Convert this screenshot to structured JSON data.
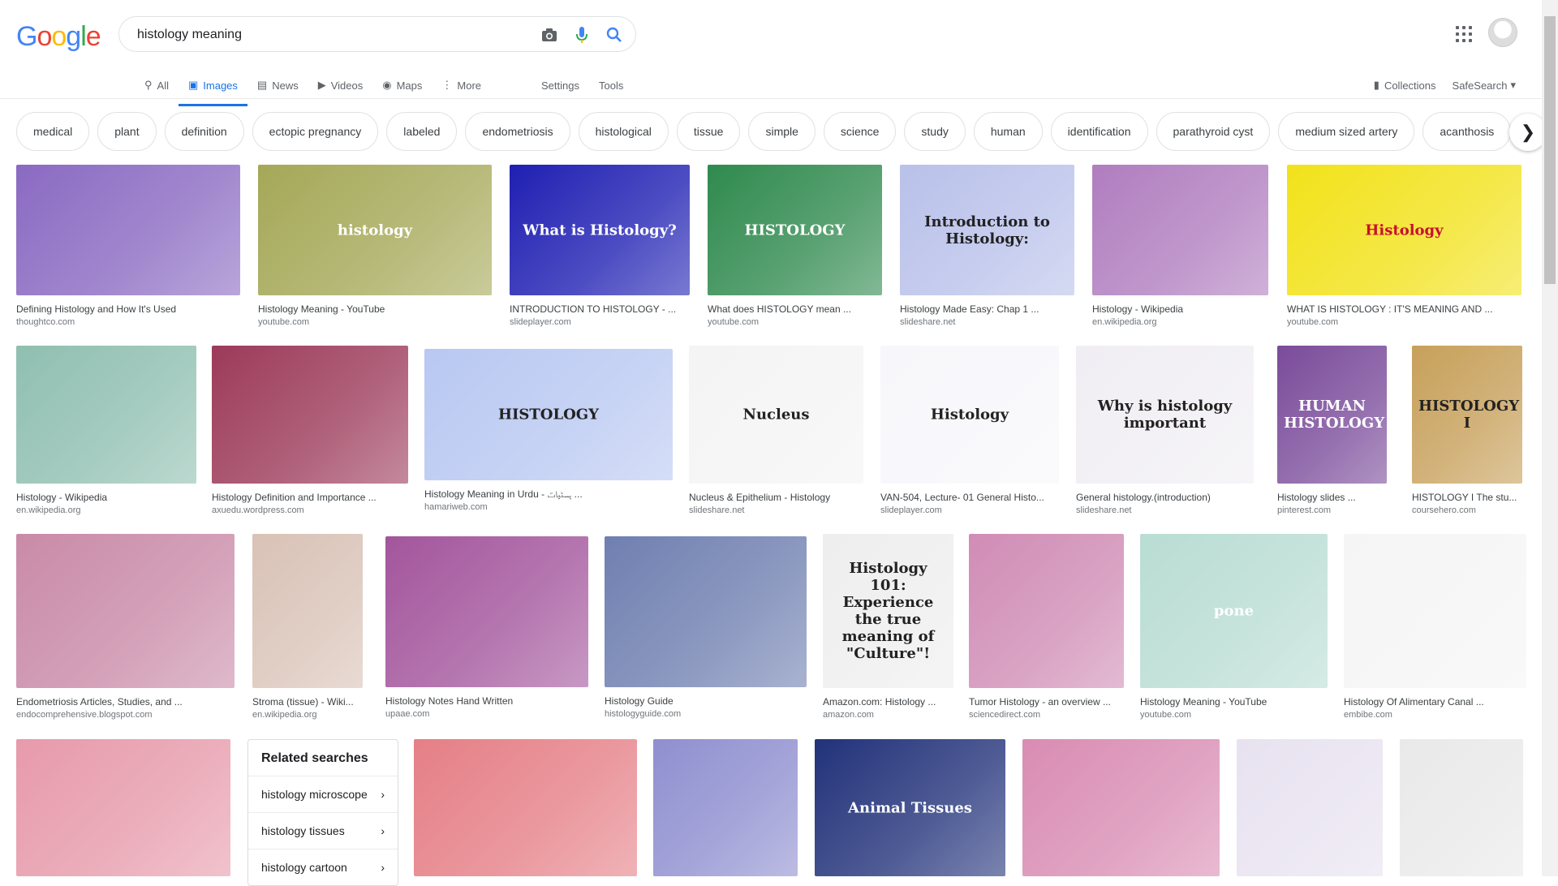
{
  "logo": "Google",
  "search": {
    "value": "histology meaning"
  },
  "tabs": [
    {
      "label": "All",
      "icon": "search-icon"
    },
    {
      "label": "Images",
      "icon": "image-icon"
    },
    {
      "label": "News",
      "icon": "news-icon"
    },
    {
      "label": "Videos",
      "icon": "video-icon"
    },
    {
      "label": "Maps",
      "icon": "map-icon"
    },
    {
      "label": "More",
      "icon": "more-icon"
    },
    {
      "label": "Settings"
    },
    {
      "label": "Tools"
    }
  ],
  "right": {
    "collections": "Collections",
    "safesearch": "SafeSearch"
  },
  "chips": [
    "medical",
    "plant",
    "definition",
    "ectopic pregnancy",
    "labeled",
    "endometriosis",
    "histological",
    "tissue",
    "simple",
    "science",
    "study",
    "human",
    "identification",
    "parathyroid cyst",
    "medium sized artery",
    "acanthosis"
  ],
  "results": [
    {
      "caption": "Defining Histology and How It's Used",
      "source": "thoughtco.com",
      "color": "#8a6ac2",
      "text": ""
    },
    {
      "caption": "Histology Meaning - YouTube",
      "source": "youtube.com",
      "color": "#a5a857",
      "text": "histology"
    },
    {
      "caption": "INTRODUCTION TO HISTOLOGY - ...",
      "source": "slideplayer.com",
      "color": "#1f1fb3",
      "text": "What is Histology?"
    },
    {
      "caption": "What does HISTOLOGY mean ...",
      "source": "youtube.com",
      "color": "#2f8a4e",
      "text": "HISTOLOGY"
    },
    {
      "caption": "Histology Made Easy: Chap 1 ...",
      "source": "slideshare.net",
      "color": "#b9c1ea",
      "text": "Introduction to Histology:"
    },
    {
      "caption": "Histology - Wikipedia",
      "source": "en.wikipedia.org",
      "color": "#b07dbf",
      "text": ""
    },
    {
      "caption": "WHAT IS HISTOLOGY : IT'S MEANING AND ...",
      "source": "youtube.com",
      "color": "#f2e21a",
      "text": "Histology"
    },
    {
      "caption": "Histology - Wikipedia",
      "source": "en.wikipedia.org",
      "color": "#8fbfb0",
      "text": ""
    },
    {
      "caption": "Histology Definition and Importance ...",
      "source": "axuedu.wordpress.com",
      "color": "#9c3a5a",
      "text": ""
    },
    {
      "caption": "Histology Meaning in Urdu - ﮨﺴﭩﯿﺎﺕ ...",
      "source": "hamariweb.com",
      "color": "#b9c8f2",
      "text": "HISTOLOGY"
    },
    {
      "caption": "Nucleus & Epithelium - Histology",
      "source": "slideshare.net",
      "color": "#f4f4f4",
      "text": "Nucleus"
    },
    {
      "caption": "VAN-504, Lecture- 01 General Histo...",
      "source": "slideplayer.com",
      "color": "#f7f7fb",
      "text": "Histology"
    },
    {
      "caption": "General histology.(introduction)",
      "source": "slideshare.net",
      "color": "#f0eef3",
      "text": "Why is histology important"
    },
    {
      "caption": "Histology slides ...",
      "source": "pinterest.com",
      "color": "#7a4b9a",
      "text": "HUMAN HISTOLOGY"
    },
    {
      "caption": "HISTOLOGY I The stu...",
      "source": "coursehero.com",
      "color": "#c7a05a",
      "text": "HISTOLOGY I"
    },
    {
      "caption": "Endometriosis Articles, Studies, and ...",
      "source": "endocomprehensive.blogspot.com",
      "color": "#c98aa8",
      "text": ""
    },
    {
      "caption": "Stroma (tissue) - Wiki...",
      "source": "en.wikipedia.org",
      "color": "#d9c2b6",
      "text": ""
    },
    {
      "caption": "Histology Notes Hand Written",
      "source": "upaae.com",
      "color": "#a3559c",
      "text": ""
    },
    {
      "caption": "Histology Guide",
      "source": "histologyguide.com",
      "color": "#6f7fb0",
      "text": ""
    },
    {
      "caption": "Amazon.com: Histology ...",
      "source": "amazon.com",
      "color": "#eeeeee",
      "text": "Histology 101: Experience the true meaning of \"Culture\"!"
    },
    {
      "caption": "Tumor Histology - an overview ...",
      "source": "sciencedirect.com",
      "color": "#d08cb5",
      "text": ""
    },
    {
      "caption": "Histology Meaning - YouTube",
      "source": "youtube.com",
      "color": "#b9ddd3",
      "text": "pone"
    },
    {
      "caption": "Histology Of Alimentary Canal ...",
      "source": "embibe.com",
      "color": "#f5f5f5",
      "text": ""
    },
    {
      "caption": "",
      "source": "",
      "color": "#e79aab",
      "text": ""
    },
    {
      "caption": "",
      "source": "",
      "color": "#e57f86",
      "text": ""
    },
    {
      "caption": "",
      "source": "",
      "color": "#8f8fd0",
      "text": ""
    },
    {
      "caption": "",
      "source": "",
      "color": "#22327a",
      "text": "Animal Tissues"
    },
    {
      "caption": "",
      "source": "",
      "color": "#d98cb3",
      "text": ""
    },
    {
      "caption": "",
      "source": "",
      "color": "#e8e2f0",
      "text": ""
    },
    {
      "caption": "",
      "source": "",
      "color": "#e9e9e9",
      "text": ""
    }
  ],
  "related": {
    "title": "Related searches",
    "items": [
      "histology microscope",
      "histology tissues",
      "histology cartoon"
    ]
  }
}
